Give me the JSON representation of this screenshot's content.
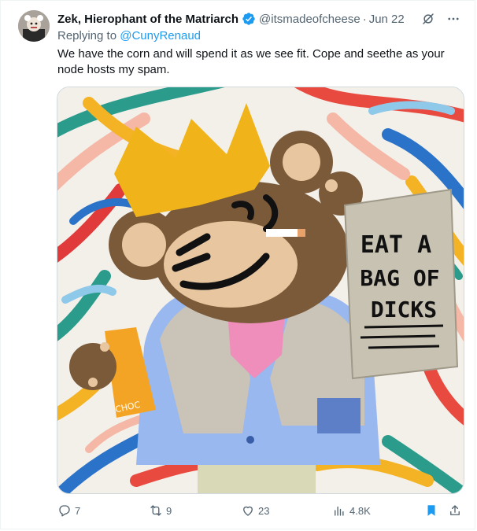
{
  "post": {
    "author_name": "Zek, Hierophant of the Matriarch",
    "author_handle": "@itsmadeofcheese",
    "separator": "·",
    "date": "Jun 22",
    "replying_prefix": "Replying to",
    "replying_to": "@CunyRenaud",
    "text": "We have the corn and will spend it as we see fit. Cope and seethe as your node hosts my spam.",
    "image_sign_lines": [
      "EAT A",
      "BAG OF",
      "DICKS"
    ],
    "image_bag_label": "CHOC"
  },
  "actions": {
    "reply_count": "7",
    "repost_count": "9",
    "like_count": "23",
    "views_count": "4.8K",
    "icons": [
      "reply-icon",
      "repost-icon",
      "like-icon",
      "views-icon",
      "bookmark-icon",
      "share-icon"
    ]
  },
  "colors": {
    "text": "#0f1419",
    "muted": "#536471",
    "link": "#1d9bf0",
    "verified": "#1d9bf0",
    "bookmark_active": "#1d9bf0"
  }
}
